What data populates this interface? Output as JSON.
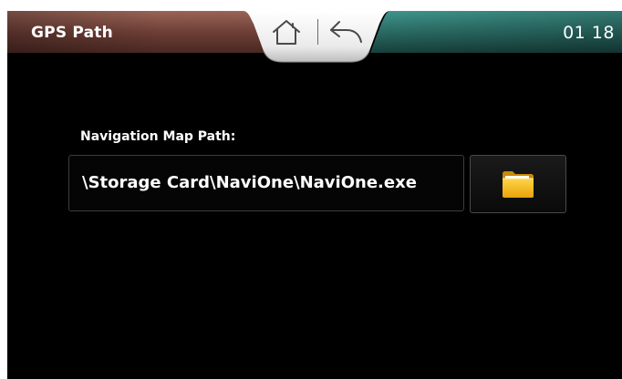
{
  "header": {
    "title": "GPS Path",
    "clock": "01 18",
    "home_icon": "home-icon",
    "back_icon": "back-arrow-icon"
  },
  "main": {
    "path_label": "Navigation Map Path:",
    "path_value": "\\Storage Card\\NaviOne\\NaviOne.exe",
    "browse_icon": "folder-icon"
  },
  "colors": {
    "background": "#000000",
    "title_bar_left": "#7a4a40",
    "title_bar_right": "#2f7b74",
    "folder": "#f3b61a",
    "text": "#ffffff"
  }
}
